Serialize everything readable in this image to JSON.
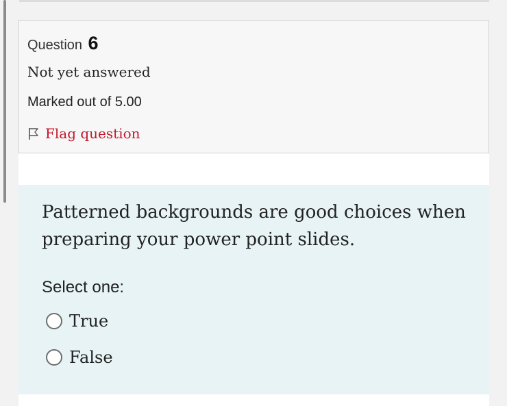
{
  "question": {
    "label": "Question",
    "number": "6",
    "state": "Not yet answered",
    "grade": "Marked out of 5.00",
    "flag_label": "Flag question",
    "text": "Patterned backgrounds are good choices when preparing your power point slides.",
    "prompt": "Select one:",
    "options": [
      {
        "label": "True"
      },
      {
        "label": "False"
      }
    ]
  },
  "colors": {
    "flag": "#c3172b",
    "content_bg": "#e7f3f5",
    "info_bg": "#f7f7f7"
  },
  "icons": {
    "flag": "flag-icon",
    "radio": "radio-icon"
  }
}
